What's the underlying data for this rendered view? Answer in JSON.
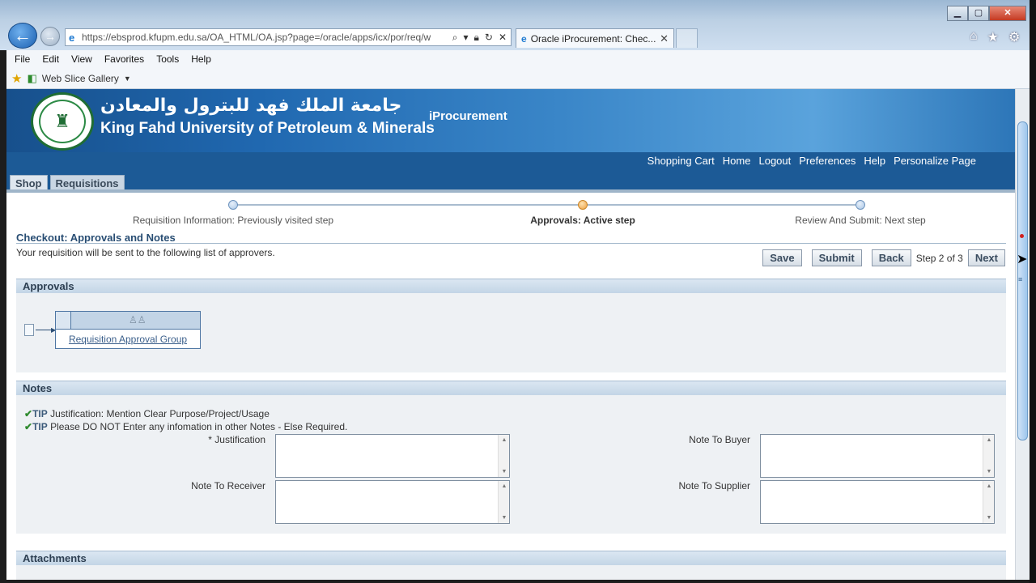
{
  "browser": {
    "url": "https://ebsprod.kfupm.edu.sa/OA_HTML/OA.jsp?page=/oracle/apps/icx/por/req/w",
    "tab_title": "Oracle iProcurement: Chec...",
    "menu": [
      "File",
      "Edit",
      "View",
      "Favorites",
      "Tools",
      "Help"
    ],
    "favorites_item": "Web Slice Gallery"
  },
  "header": {
    "university_arabic": "جامعة الملك فهد للبترول والمعادن",
    "university_english": "King Fahd University of Petroleum & Minerals",
    "app_name": "iProcurement",
    "global_links": [
      "Shopping Cart",
      "Home",
      "Logout",
      "Preferences",
      "Help",
      "Personalize Page"
    ],
    "tabs": [
      "Shop",
      "Requisitions"
    ]
  },
  "train": {
    "steps": [
      {
        "label": "Requisition Information: Previously visited step",
        "state": "visited"
      },
      {
        "label": "Approvals: Active step",
        "state": "active"
      },
      {
        "label": "Review And Submit: Next step",
        "state": "next"
      }
    ]
  },
  "page": {
    "title": "Checkout: Approvals and Notes",
    "instruction": "Your requisition will be sent to the following list of approvers.",
    "buttons": {
      "save": "Save",
      "submit": "Submit",
      "back": "Back",
      "next": "Next"
    },
    "step_text": "Step 2 of 3"
  },
  "approvals": {
    "heading": "Approvals",
    "group_link": "Requisition Approval Group"
  },
  "notes": {
    "heading": "Notes",
    "tips": [
      {
        "label": "TIP",
        "text": "Justification: Mention Clear Purpose/Project/Usage"
      },
      {
        "label": "TIP",
        "text": "Please DO NOT Enter any infomation in other Notes - Else Required."
      }
    ],
    "fields": {
      "justification": "* Justification",
      "note_to_receiver": "Note To Receiver",
      "note_to_buyer": "Note To Buyer",
      "note_to_supplier": "Note To Supplier"
    }
  },
  "attachments": {
    "heading": "Attachments"
  },
  "colors": {
    "brand_blue": "#1c5a96",
    "section_header": "#c3d5e6",
    "active_step": "#ee9f3f"
  }
}
